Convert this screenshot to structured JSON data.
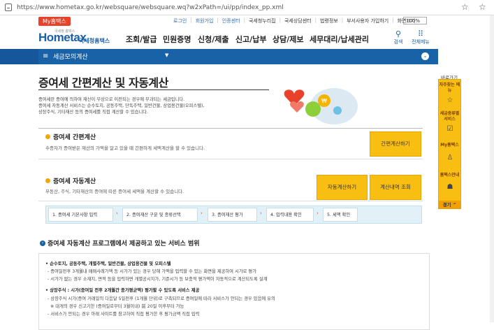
{
  "browser": {
    "url": "https://www.hometax.go.kr/websquare/websquare.wq?w2xPath=/ui/pp/index_pp.xml"
  },
  "util": {
    "myhometax": "My홈택스",
    "links": [
      {
        "label": "로그인",
        "tone": "blue"
      },
      {
        "label": "회원가입",
        "tone": "blue"
      },
      {
        "label": "인증센터",
        "tone": "blue"
      },
      {
        "label": "국세청누리집",
        "tone": "gray"
      },
      {
        "label": "국세상담센터",
        "tone": "gray"
      },
      {
        "label": "법령정보",
        "tone": "gray"
      },
      {
        "label": "부서사용자 가입하기",
        "tone": "gray"
      },
      {
        "label": "화면크기",
        "tone": "gray"
      }
    ],
    "zoom": "100%"
  },
  "header": {
    "logo": "Hometax",
    "logo_top": "국세청 홈택스",
    "logo_sub": "국세청홈택스",
    "menu": [
      "조회/발급",
      "민원증명",
      "신청/제출",
      "신고/납부",
      "상담/제보",
      "세무대리/납세관리"
    ],
    "search_label": "검색",
    "all_menu_label": "전체메뉴"
  },
  "nav": {
    "title": "세금모의계산"
  },
  "main": {
    "title": "증여세 간편계산 및 자동계산",
    "desc": [
      "증여세란 증여에 의하여 재산이 무상으로 이전되는 경우에 부과되는 세금입니다.",
      "증여세 자동계산 서비스는 순수토지, 공동주택, 단독주택, 일반건물, 상업용건물(오피스텔),",
      "상장주식, 기타재산 등의 증여세를 직접 계산할 수 있습니다."
    ],
    "simple": {
      "title": "증여세 간편계산",
      "desc": "수증자가 증여받은 재산의 가액을 알고 있을 때 간편하게 세액계산을 할 수 있습니다.",
      "button": "간편계산하기"
    },
    "auto": {
      "title": "증여세 자동계산",
      "desc": "부동산, 주식, 기타재산의 증여에 따른 증여세 세액을 계산할 수 있습니다.",
      "button_auto": "자동계산하기",
      "button_history": "계산내역 조회"
    },
    "steps": [
      "1. 증여세 기본사항 입력",
      "2. 증여재산 구분 및 종류선택",
      "3. 증여재산 평가",
      "4. 입력내용 확인",
      "5. 세액 확인"
    ]
  },
  "service": {
    "title": "증여세 자동계산 프로그램에서 제공하고 있는 서비스 범위",
    "lines": [
      "• 순수토지, 공동주택, 개별주택, 일반건물, 상업용건물 및 오피스텔",
      "- 증여일전후 3개월내 매매사례가액 등 시가가 있는 경우 당해 가액을 입력할 수 있는 화면을 제공하여 시가로 평가",
      "- 시가가 없는 경우 소재지, 면적 등을 입력하면 개별공시지가, 기준시가 등 보충적 평가액이 자동적으로 계산되도록 설계",
      "• 상장주식 : 시가(증여일 전후 2개월간 종가평균액) 평가할 수 있도록 서비스 제공",
      "- 상장주식 시가(증여 거래일의 다음달 5일전후 (1개월 단위)로 구축되므로 증여일에 따라 서비스가 안되는 경우 있음에 유의",
      "※ 대개의 경우 신고기한 (증여일로부터 3월이내) 前 20일 이후부터 가능",
      "- 서비스가 안되는 경우 아래 사이트를 참고하여 직접 평가한 후 평가금액 직접 입력"
    ]
  },
  "quick": {
    "label": "바로가기",
    "items": [
      {
        "label": "자주찾는 메뉴",
        "icon": "star-icon"
      },
      {
        "label": "세금종류별 서비스",
        "icon": "check-icon"
      },
      {
        "label": "My홈택스",
        "icon": "user-icon"
      },
      {
        "label": "홈택스안내",
        "icon": "info-icon"
      }
    ],
    "top": "경기 ^"
  }
}
